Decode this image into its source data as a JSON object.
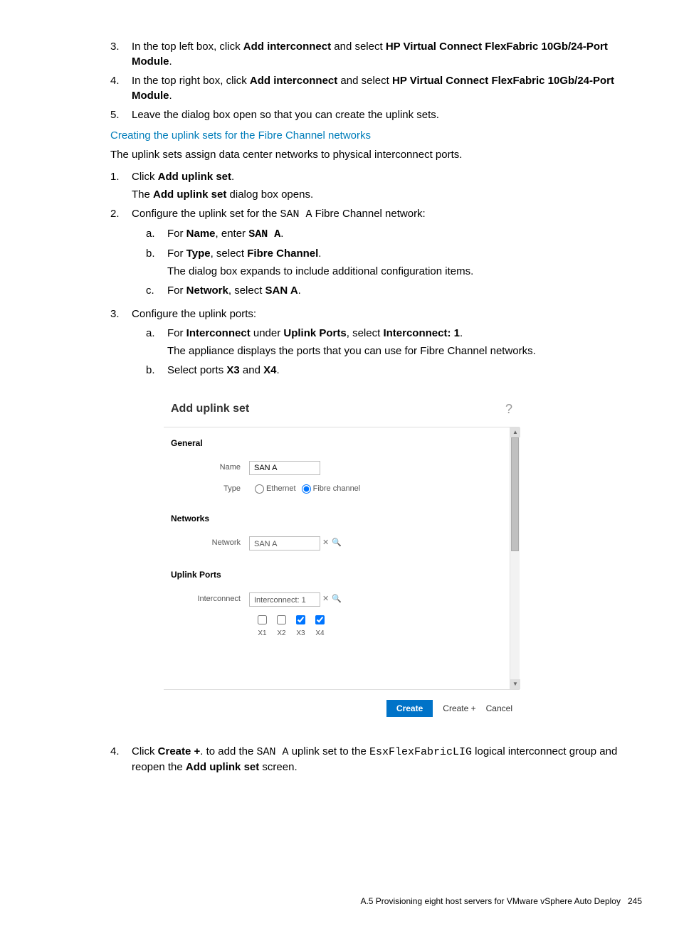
{
  "steps_a": {
    "s3": {
      "idx": "3.",
      "prefix": "In the top left box, click ",
      "b1": "Add interconnect",
      "mid": " and select ",
      "b2": "HP Virtual Connect FlexFabric 10Gb/24-Port Module",
      "suffix": "."
    },
    "s4": {
      "idx": "4.",
      "prefix": "In the top right box, click ",
      "b1": "Add interconnect",
      "mid": " and select ",
      "b2": "HP Virtual Connect FlexFabric 10Gb/24-Port Module",
      "suffix": "."
    },
    "s5": {
      "idx": "5.",
      "text": "Leave the dialog box open so that you can create the uplink sets."
    }
  },
  "heading": "Creating the uplink sets for the Fibre Channel networks",
  "intro": "The uplink sets assign data center networks to physical interconnect ports.",
  "steps_b": {
    "s1": {
      "idx": "1.",
      "l1a": "Click ",
      "l1b": "Add uplink set",
      "l1c": ".",
      "l2a": "The ",
      "l2b": "Add uplink set",
      "l2c": " dialog box opens."
    },
    "s2": {
      "idx": "2.",
      "texta": "Configure the uplink set for the ",
      "mono": "SAN A",
      "textb": " Fibre Channel network:",
      "a": {
        "idx": "a.",
        "t1": "For ",
        "b1": "Name",
        "t2": ", enter ",
        "m1": "SAN A",
        "t3": "."
      },
      "b": {
        "idx": "b.",
        "t1": "For ",
        "b1": "Type",
        "t2": ", select ",
        "b2": "Fibre Channel",
        "t3": ".",
        "sub": "The dialog box expands to include additional configuration items."
      },
      "c": {
        "idx": "c.",
        "t1": "For ",
        "b1": "Network",
        "t2": ", select ",
        "b2": "SAN A",
        "t3": "."
      }
    },
    "s3": {
      "idx": "3.",
      "text": "Configure the uplink ports:",
      "a": {
        "idx": "a.",
        "t1": "For ",
        "b1": "Interconnect",
        "t2": " under ",
        "b2": "Uplink Ports",
        "t3": ", select ",
        "b3": "Interconnect: 1",
        "t4": ".",
        "sub": "The appliance displays the ports that you can use for Fibre Channel networks."
      },
      "b": {
        "idx": "b.",
        "t1": "Select ports ",
        "b1": "X3",
        "t2": " and ",
        "b2": "X4",
        "t3": "."
      }
    },
    "s4": {
      "idx": "4.",
      "t1": "Click ",
      "b1": "Create +",
      "t2": ". to add the ",
      "m1": "SAN A",
      "t3": " uplink set to the ",
      "m2": "EsxFlexFabricLIG",
      "t4": " logical interconnect group and reopen the ",
      "b2": "Add uplink set",
      "t5": " screen."
    }
  },
  "dialog": {
    "title": "Add uplink set",
    "help": "?",
    "sec_general": "General",
    "lbl_name": "Name",
    "val_name": "SAN A",
    "lbl_type": "Type",
    "opt_eth": "Ethernet",
    "opt_fc": "Fibre channel",
    "sec_networks": "Networks",
    "lbl_network": "Network",
    "val_network": "SAN A",
    "sec_uplink": "Uplink Ports",
    "lbl_interconnect": "Interconnect",
    "val_interconnect": "Interconnect: 1",
    "ports": {
      "x1": "X1",
      "x2": "X2",
      "x3": "X3",
      "x4": "X4"
    },
    "btn_create": "Create",
    "btn_createplus": "Create +",
    "btn_cancel": "Cancel"
  },
  "footer": {
    "text": "A.5 Provisioning eight host servers for VMware vSphere Auto Deploy",
    "page": "245"
  }
}
